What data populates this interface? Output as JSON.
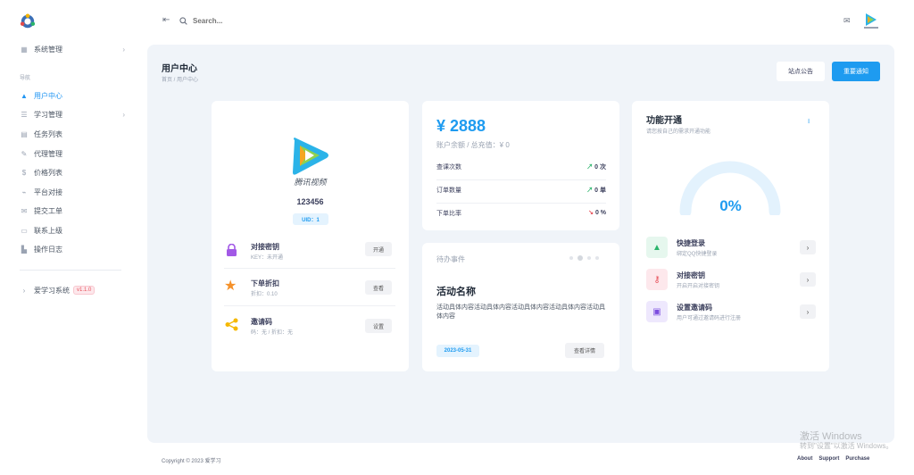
{
  "sidebar": {
    "top_item": "系统管理",
    "nav_heading": "导航",
    "items": [
      {
        "label": "用户中心",
        "icon": "user-icon",
        "active": true
      },
      {
        "label": "学习管理",
        "icon": "book-icon",
        "chevron": true
      },
      {
        "label": "任务列表",
        "icon": "list-icon"
      },
      {
        "label": "代理管理",
        "icon": "edit-icon"
      },
      {
        "label": "价格列表",
        "icon": "dollar-icon"
      },
      {
        "label": "平台对接",
        "icon": "link-icon"
      },
      {
        "label": "提交工单",
        "icon": "mail-icon"
      },
      {
        "label": "联系上级",
        "icon": "chat-icon"
      },
      {
        "label": "操作日志",
        "icon": "chart-icon"
      }
    ],
    "app_name": "爱学习系统",
    "version": "v1.1.0"
  },
  "topbar": {
    "search_placeholder": "Search..."
  },
  "page": {
    "title": "用户中心",
    "breadcrumb": "首页 / 用户中心",
    "btn_notice": "站点公告",
    "btn_important": "重要通知"
  },
  "profile": {
    "logo_text": "腾讯视频",
    "user_id": "123456",
    "uid_label": "UID：1",
    "rows": [
      {
        "title": "对接密钥",
        "sub": "KEY：未开通",
        "action": "开通"
      },
      {
        "title": "下单折扣",
        "sub": "折扣：0.10",
        "action": "查看"
      },
      {
        "title": "邀请码",
        "sub": "码：无 / 折扣：无",
        "action": "设置"
      }
    ]
  },
  "balance": {
    "amount": "¥ 2888",
    "sub": "账户余额 / 总充值：¥ 0",
    "stats": [
      {
        "label": "查课次数",
        "value": "0 次",
        "trend": "up"
      },
      {
        "label": "订单数量",
        "value": "0 单",
        "trend": "up"
      },
      {
        "label": "下单比率",
        "value": "0 %",
        "trend": "down"
      }
    ]
  },
  "todo": {
    "heading": "待办事件",
    "activity_title": "活动名称",
    "activity_body": "活动具体内容活动具体内容活动具体内容活动具体内容活动具体内容",
    "date": "2023-05-31",
    "detail_btn": "查看详情"
  },
  "features": {
    "title": "功能开通",
    "subtitle": "请您按自己的需求开通功能",
    "percent": "0%",
    "progress": 0,
    "items": [
      {
        "title": "快捷登录",
        "sub": "绑定QQ快捷登录",
        "color": "#e6f7ee",
        "icon": "tree-icon"
      },
      {
        "title": "对接密钥",
        "sub": "开启开启对接密钥",
        "color": "#fde8ec",
        "icon": "key-icon"
      },
      {
        "title": "设置邀请码",
        "sub": "用户可通过邀请码进行注册",
        "color": "#eee8fd",
        "icon": "gift-icon"
      }
    ]
  },
  "footer": {
    "copyright": "Copyright © 2023 爱学习",
    "links": [
      "About",
      "Support",
      "Purchase"
    ]
  },
  "watermark": {
    "line1": "激活 Windows",
    "line2": "转到\"设置\"以激活 Windows。"
  },
  "colors": {
    "primary": "#2196f3",
    "bg": "#f0f4f9"
  }
}
